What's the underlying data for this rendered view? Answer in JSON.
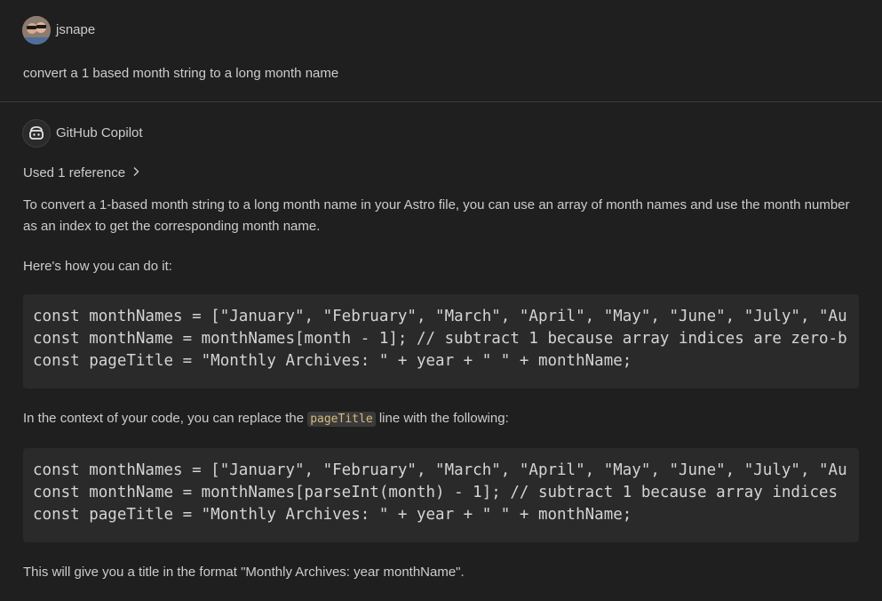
{
  "user": {
    "name": "jsnape",
    "message": "convert a 1 based month string to a long month name"
  },
  "assistant": {
    "name": "GitHub Copilot",
    "references_label": "Used 1 reference"
  },
  "response": {
    "intro": "To convert a 1-based month string to a long month name in your Astro file, you can use an array of month names and use the month number as an index to get the corresponding month name.",
    "howto": "Here's how you can do it:",
    "code1": [
      "const monthNames = [\"January\", \"February\", \"March\", \"April\", \"May\", \"June\", \"July\", \"Au",
      "const monthName = monthNames[month - 1]; // subtract 1 because array indices are zero-b",
      "const pageTitle = \"Monthly Archives: \" + year + \" \" + monthName;"
    ],
    "context_before": "In the context of your code, you can replace the ",
    "context_code": "pageTitle",
    "context_after": " line with the following:",
    "code2": [
      "const monthNames = [\"January\", \"February\", \"March\", \"April\", \"May\", \"June\", \"July\", \"Au",
      "const monthName = monthNames[parseInt(month) - 1]; // subtract 1 because array indices",
      "const pageTitle = \"Monthly Archives: \" + year + \" \" + monthName;"
    ],
    "outro": "This will give you a title in the format \"Monthly Archives: year monthName\"."
  },
  "icons": {
    "user_avatar": "avatar-photo",
    "assistant_avatar": "copilot-icon",
    "references_toggle": "chevron-right-icon"
  }
}
